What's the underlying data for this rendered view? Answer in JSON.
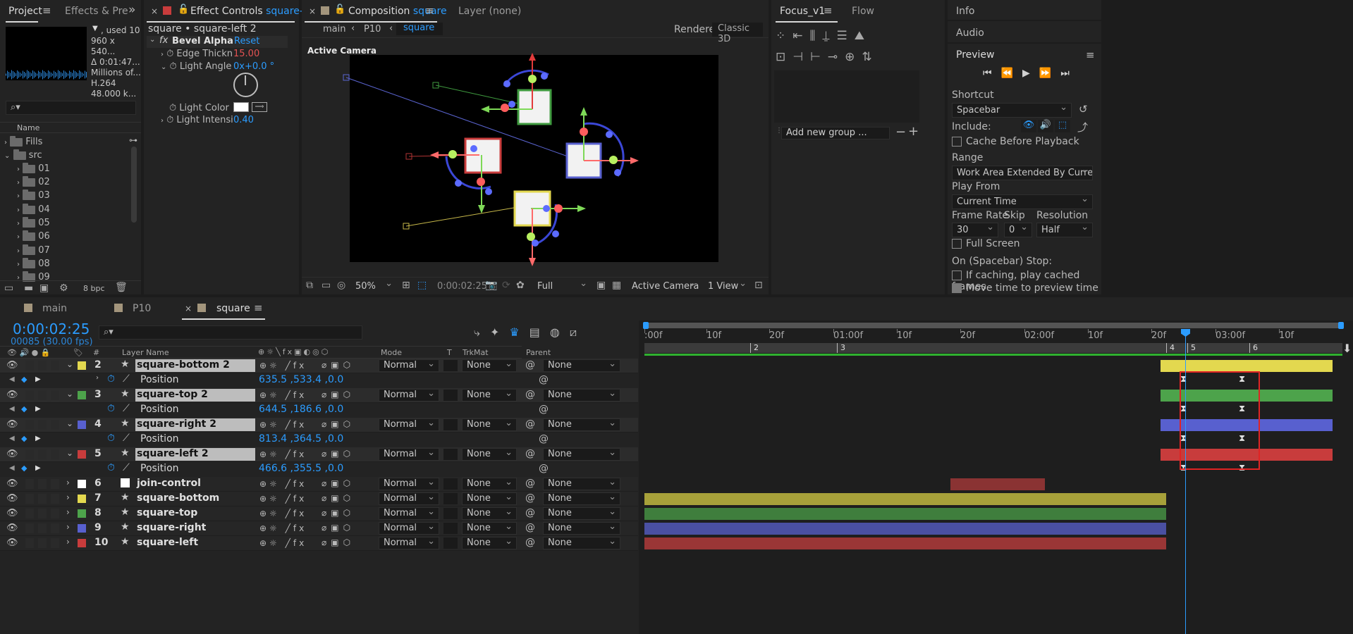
{
  "colors": {
    "accent": "#2b9cff",
    "yellow": "#e3d84f",
    "green": "#4da34b",
    "blue": "#5860cf",
    "red": "#c83c3c"
  },
  "project": {
    "tab_project": "Project",
    "tab_effects": "Effects & Pre",
    "info": {
      "used": ", used 10",
      "size": "960 x 540...",
      "dur": "Δ 0:01:47...",
      "colors": "Millions of...",
      "codec": "H.264",
      "audio": "48.000 k..."
    },
    "col_name": "Name",
    "items": [
      "Fills",
      "src",
      "01",
      "02",
      "03",
      "04",
      "05",
      "06",
      "07",
      "08",
      "09"
    ],
    "bpc": "8 bpc"
  },
  "effect_controls": {
    "tab": "Effect Controls",
    "tab_layer": "square-left",
    "breadcrumb": "square • square-left 2",
    "effect_name": "Bevel Alpha",
    "reset": "Reset",
    "props": [
      {
        "name": "Edge Thickn",
        "value": "15.00"
      },
      {
        "name": "Light Angle",
        "value": "0x+0.0 °"
      },
      {
        "name": "Light Color",
        "value": ""
      },
      {
        "name": "Light Intensi",
        "value": "0.40"
      }
    ]
  },
  "composition": {
    "tab": "Composition",
    "tab_name": "square",
    "layer_tab": "Layer  (none)",
    "crumbs": [
      "main",
      "P10",
      "square"
    ],
    "renderer_label": "Renderer:",
    "renderer": "Classic 3D",
    "camera_label": "Active Camera",
    "zoom": "50%",
    "time": "0:00:02:25",
    "resolution": "Full",
    "view": "Active Camera",
    "views": "1 View"
  },
  "focus": {
    "tab": "Focus_v1",
    "tab_flow": "Flow",
    "add_group": "Add new group ..."
  },
  "preview": {
    "info": "Info",
    "audio": "Audio",
    "title": "Preview",
    "shortcut_label": "Shortcut",
    "shortcut": "Spacebar",
    "include_label": "Include:",
    "cache_before": "Cache Before Playback",
    "range_label": "Range",
    "range": "Work Area Extended By Current...",
    "play_from_label": "Play From",
    "play_from": "Current Time",
    "frame_rate_label": "Frame Rate",
    "skip_label": "Skip",
    "resolution_label": "Resolution",
    "frame_rate": "30",
    "skip": "0",
    "resolution": "Half",
    "full_screen": "Full Screen",
    "stop_label": "On (Spacebar) Stop:",
    "if_caching": "If caching, play cached frames",
    "move_time": "Move time to preview time"
  },
  "timeline": {
    "tabs": [
      "main",
      "P10",
      "square"
    ],
    "timecode": "0:00:02:25",
    "fps": "00085 (30.00 fps)",
    "headers": {
      "num": "#",
      "layer_name": "Layer Name",
      "mode": "Mode",
      "t": "T",
      "trkmat": "TrkMat",
      "parent": "Parent & Link"
    },
    "ruler": [
      ":00f",
      "10f",
      "20f",
      "01:00f",
      "10f",
      "20f",
      "02:00f",
      "10f",
      "20f",
      "03:00f",
      "10f"
    ],
    "markers": [
      "2",
      "3",
      "4",
      "5",
      "6"
    ],
    "layers": [
      {
        "num": "2",
        "name": "square-bottom 2",
        "color": "#e3d84f",
        "mode": "Normal",
        "trkmat": "None",
        "parent": "None",
        "position": "635.5 ,533.4 ,0.0"
      },
      {
        "num": "3",
        "name": "square-top 2",
        "color": "#4da34b",
        "mode": "Normal",
        "trkmat": "None",
        "parent": "None",
        "position": "644.5 ,186.6 ,0.0"
      },
      {
        "num": "4",
        "name": "square-right 2",
        "color": "#5860cf",
        "mode": "Normal",
        "trkmat": "None",
        "parent": "None",
        "position": "813.4 ,364.5 ,0.0"
      },
      {
        "num": "5",
        "name": "square-left 2",
        "color": "#c83c3c",
        "mode": "Normal",
        "trkmat": "None",
        "parent": "None",
        "position": "466.6 ,355.5 ,0.0"
      },
      {
        "num": "6",
        "name": "join-control",
        "color": "#ffffff",
        "mode": "Normal",
        "trkmat": "None",
        "parent": "None"
      },
      {
        "num": "7",
        "name": "square-bottom",
        "color": "#e3d84f",
        "mode": "Normal",
        "trkmat": "None",
        "parent": "None"
      },
      {
        "num": "8",
        "name": "square-top",
        "color": "#4da34b",
        "mode": "Normal",
        "trkmat": "None",
        "parent": "None"
      },
      {
        "num": "9",
        "name": "square-right",
        "color": "#5860cf",
        "mode": "Normal",
        "trkmat": "None",
        "parent": "None"
      },
      {
        "num": "10",
        "name": "square-left",
        "color": "#c83c3c",
        "mode": "Normal",
        "trkmat": "None",
        "parent": "None"
      }
    ],
    "position_label": "Position"
  }
}
